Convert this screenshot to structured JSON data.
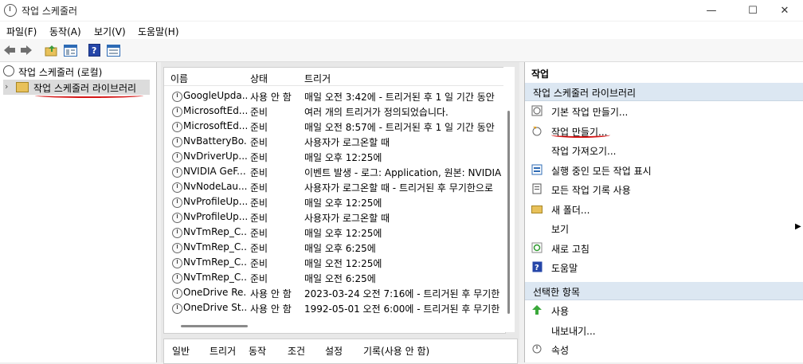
{
  "window": {
    "title": "작업 스케줄러"
  },
  "menu": [
    "파일(F)",
    "동작(A)",
    "보기(V)",
    "도움말(H)"
  ],
  "tree": {
    "root": "작업 스케줄러 (로컬)",
    "library": "작업 스케줄러 라이브러리"
  },
  "list": {
    "columns": [
      "이름",
      "상태",
      "트리거"
    ],
    "rows": [
      {
        "name": "GoogleUpda...",
        "status": "사용 안 함",
        "trigger": "매일 오전 3:42에 - 트리거된 후 1 일 기간 동안"
      },
      {
        "name": "MicrosoftEd...",
        "status": "준비",
        "trigger": "여러 개의 트리거가 정의되었습니다."
      },
      {
        "name": "MicrosoftEd...",
        "status": "준비",
        "trigger": "매일 오전 8:57에 - 트리거된 후 1 일 기간 동안"
      },
      {
        "name": "NvBatteryBo...",
        "status": "준비",
        "trigger": "사용자가 로그온할 때"
      },
      {
        "name": "NvDriverUp...",
        "status": "준비",
        "trigger": "매일 오후 12:25에"
      },
      {
        "name": "NVIDIA GeF...",
        "status": "준비",
        "trigger": "이벤트 발생 - 로그: Application, 원본: NVIDIA"
      },
      {
        "name": "NvNodeLau...",
        "status": "준비",
        "trigger": "사용자가 로그온할 때 - 트리거된 후 무기한으로"
      },
      {
        "name": "NvProfileUp...",
        "status": "준비",
        "trigger": "매일 오후 12:25에"
      },
      {
        "name": "NvProfileUp...",
        "status": "준비",
        "trigger": "사용자가 로그온할 때"
      },
      {
        "name": "NvTmRep_C...",
        "status": "준비",
        "trigger": "매일 오후 12:25에"
      },
      {
        "name": "NvTmRep_C...",
        "status": "준비",
        "trigger": "매일 오후 6:25에"
      },
      {
        "name": "NvTmRep_C...",
        "status": "준비",
        "trigger": "매일 오전 12:25에"
      },
      {
        "name": "NvTmRep_C...",
        "status": "준비",
        "trigger": "매일 오전 6:25에"
      },
      {
        "name": "OneDrive Re...",
        "status": "사용 안 함",
        "trigger": "2023-03-24 오전 7:16에 - 트리거된 후 무기한"
      },
      {
        "name": "OneDrive St...",
        "status": "사용 안 함",
        "trigger": "1992-05-01 오전 6:00에 - 트리거된 후 무기한"
      }
    ]
  },
  "detail_tabs": [
    "일반",
    "트리거",
    "동작",
    "조건",
    "설정",
    "기록(사용 안 함)"
  ],
  "actions": {
    "header": "작업",
    "section1": "작업 스케줄러 라이브러리",
    "items1": [
      {
        "label": "기본 작업 만들기...",
        "icon": "basic-task-icon"
      },
      {
        "label": "작업 만들기...",
        "icon": "create-task-icon"
      },
      {
        "label": "작업 가져오기...",
        "icon": ""
      },
      {
        "label": "실행 중인 모든 작업 표시",
        "icon": "running-tasks-icon"
      },
      {
        "label": "모든 작업 기록 사용",
        "icon": "history-icon"
      },
      {
        "label": "새 폴더...",
        "icon": "folder-icon"
      },
      {
        "label": "보기",
        "icon": ""
      },
      {
        "label": "새로 고침",
        "icon": "refresh-icon"
      },
      {
        "label": "도움말",
        "icon": "help-icon"
      }
    ],
    "section2": "선택한 항목",
    "items2": [
      {
        "label": "사용",
        "icon": "enable-arrow-icon"
      },
      {
        "label": "내보내기...",
        "icon": ""
      },
      {
        "label": "속성",
        "icon": "properties-icon"
      }
    ]
  },
  "colors": {
    "section_bg": "#dce7f2",
    "annotation_red": "#d31616",
    "selected_bg": "#dcdcdc"
  }
}
